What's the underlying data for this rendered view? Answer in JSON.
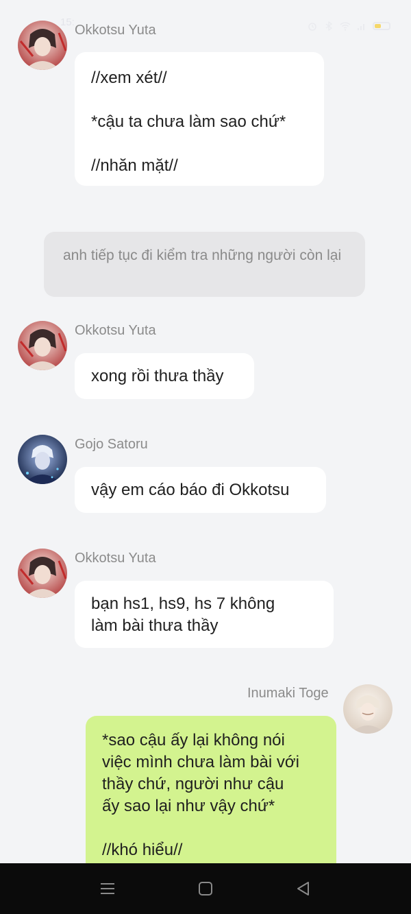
{
  "status": {
    "time": "15:"
  },
  "messages": [
    {
      "sender": "Okkotsu Yuta",
      "lines": [
        "//xem xét//",
        "",
        "*cậu ta chưa làm sao chứ*",
        "",
        "//nhăn mặt//"
      ]
    },
    {
      "narration": "anh tiếp tục đi kiểm tra những người còn lại"
    },
    {
      "sender": "Okkotsu Yuta",
      "text": "xong rồi thưa thầy"
    },
    {
      "sender": "Gojo Satoru",
      "text": "vậy em cáo báo đi Okkotsu"
    },
    {
      "sender": "Okkotsu Yuta",
      "lines": [
        "bạn hs1, hs9, hs 7 không",
        "làm bài thưa thầy"
      ]
    },
    {
      "sender": "Inumaki Toge",
      "lines": [
        "*sao cậu ấy lại không nói",
        "việc mình chưa làm bài với",
        "thầy chứ, người như cậu",
        "ấy sao lại như vậy chứ*",
        "",
        "//khó hiểu//"
      ]
    }
  ],
  "colors": {
    "background": "#f3f4f6",
    "bubble": "#ffffff",
    "own_bubble": "#d3f38f",
    "narration_bg": "#e6e6e8"
  },
  "icons": [
    "menu-icon",
    "home-icon",
    "back-icon"
  ]
}
